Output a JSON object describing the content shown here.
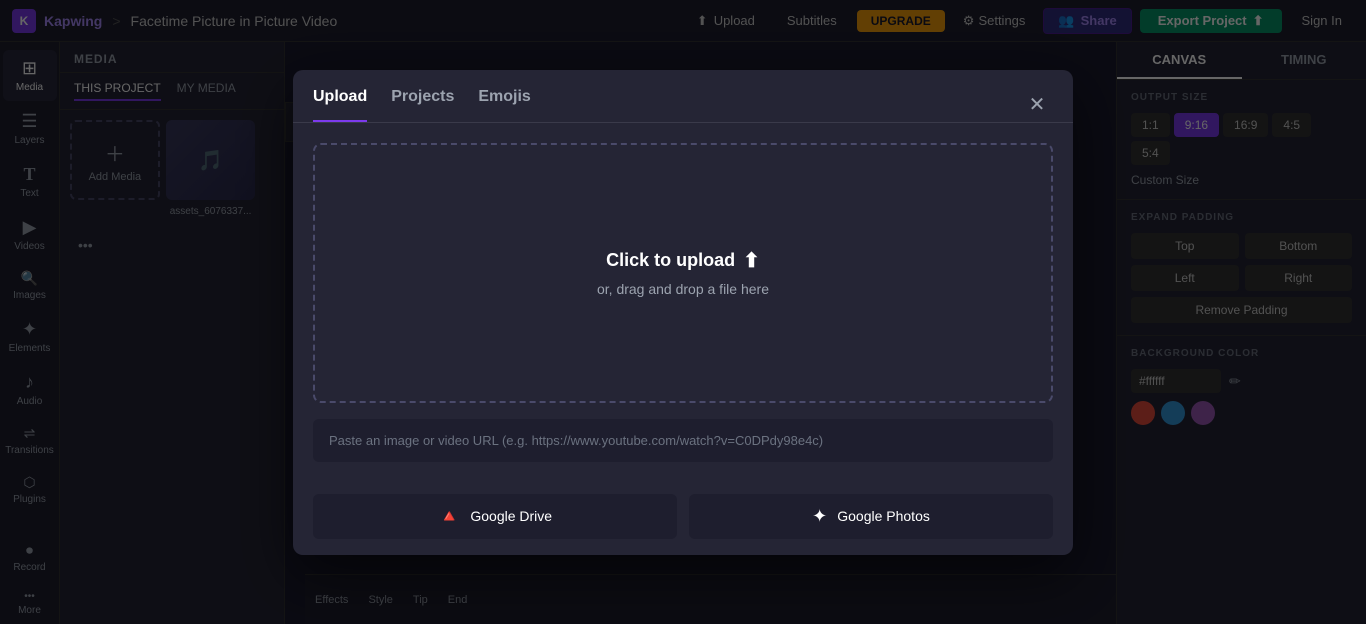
{
  "topnav": {
    "logo_text": "K",
    "brand": "Kapwing",
    "separator": ">",
    "title": "Facetime Picture in Picture Video",
    "upload_label": "Upload",
    "subtitles_label": "Subtitles",
    "upgrade_label": "UPGRADE",
    "settings_label": "Settings",
    "share_label": "Share",
    "export_label": "Export Project",
    "signin_label": "Sign In"
  },
  "sidebar": {
    "items": [
      {
        "icon": "⊞",
        "label": "Media"
      },
      {
        "icon": "☰",
        "label": "Layers"
      },
      {
        "icon": "T",
        "label": "Text"
      },
      {
        "icon": "▶",
        "label": "Videos"
      },
      {
        "icon": "🔍",
        "label": "Images"
      },
      {
        "icon": "✦",
        "label": "Elements"
      },
      {
        "icon": "♪",
        "label": "Audio"
      },
      {
        "icon": "↔",
        "label": "Transitions"
      },
      {
        "icon": "⬡",
        "label": "Plugins"
      }
    ],
    "record_label": "Record",
    "more_label": "More"
  },
  "media_panel": {
    "header": "MEDIA",
    "tabs": [
      "THIS PROJECT",
      "MY MEDIA"
    ],
    "active_tab": "THIS PROJECT",
    "add_media_label": "Add Media",
    "media_item_name": "assets_6076337..."
  },
  "right_panel": {
    "tabs": [
      "CANVAS",
      "TIMING"
    ],
    "active_tab": "CANVAS",
    "output_size_label": "OUTPUT SIZE",
    "ratio_buttons": [
      "1:1",
      "9:16",
      "16:9",
      "4:5",
      "5:4"
    ],
    "active_ratio": "9:16",
    "custom_size_label": "Custom Size",
    "expand_padding_label": "EXPAND PADDING",
    "padding_top": "Top",
    "padding_bottom": "Bottom",
    "padding_left": "Left",
    "padding_right": "Right",
    "remove_padding_label": "Remove Padding",
    "bg_color_label": "BACKGROUND COLOR",
    "hex_value": "#ffffff",
    "swatches": [
      "#e74c3c",
      "#3498db",
      "#9b59b6"
    ]
  },
  "modal": {
    "tabs": [
      "Upload",
      "Projects",
      "Emojis"
    ],
    "active_tab": "Upload",
    "upload_text": "Click to upload",
    "upload_sub": "or, drag and drop a file here",
    "url_placeholder": "Paste an image or video URL (e.g. https://www.youtube.com/watch?v=C0DPdy98e4c)",
    "google_drive_label": "Google Drive",
    "google_photos_label": "Google Photos"
  },
  "timeline": {
    "items": [
      "Effects",
      "Style",
      "Tip",
      "End"
    ]
  }
}
